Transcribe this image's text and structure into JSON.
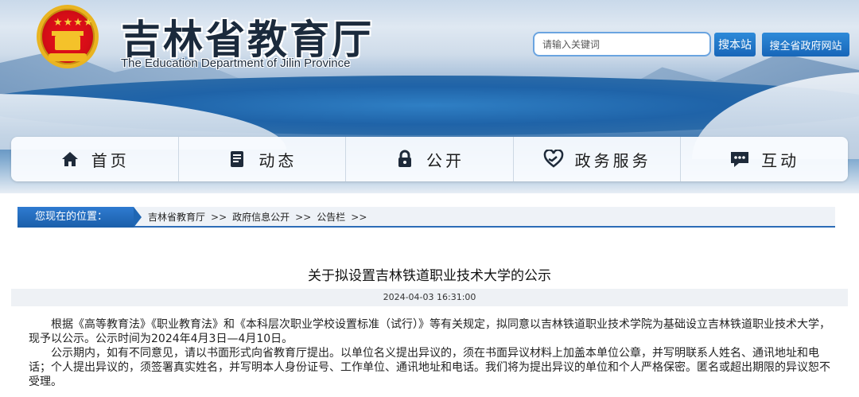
{
  "header": {
    "title_cn": "吉林省教育厅",
    "title_en": "The Education Department of Jilin Province",
    "search": {
      "placeholder": "请输入关键词",
      "site_button": "搜本站",
      "all_button": "搜全省政府网站"
    }
  },
  "nav": {
    "items": [
      {
        "label": "首页",
        "icon": "home-icon"
      },
      {
        "label": "动态",
        "icon": "document-icon"
      },
      {
        "label": "公开",
        "icon": "lock-icon"
      },
      {
        "label": "政务服务",
        "icon": "heart-hands-icon"
      },
      {
        "label": "互动",
        "icon": "chat-icon"
      }
    ]
  },
  "breadcrumb": {
    "label": "您现在的位置：",
    "items": [
      "吉林省教育厅",
      "政府信息公开",
      "公告栏"
    ],
    "separator": ">>"
  },
  "article": {
    "title": "关于拟设置吉林铁道职业技术大学的公示",
    "date": "2024-04-03 16:31:00",
    "paragraphs": [
      "根据《高等教育法》《职业教育法》和《本科层次职业学校设置标准（试行）》等有关规定，拟同意以吉林铁道职业技术学院为基础设立吉林铁道职业技术大学，现予以公示。公示时间为2024年4月3日—4月10日。",
      "公示期内，如有不同意见，请以书面形式向省教育厅提出。以单位名义提出异议的，须在书面异议材料上加盖本单位公章，并写明联系人姓名、通讯地址和电话；个人提出异议的，须签署真实姓名，并写明本人身份证号、工作单位、通讯地址和电话。我们将为提出异议的单位和个人严格保密。匿名或超出期限的异议恕不受理。"
    ]
  },
  "colors": {
    "accent": "#1a5ea9",
    "emblem_red": "#d60d17",
    "emblem_gold": "#e9b421"
  }
}
